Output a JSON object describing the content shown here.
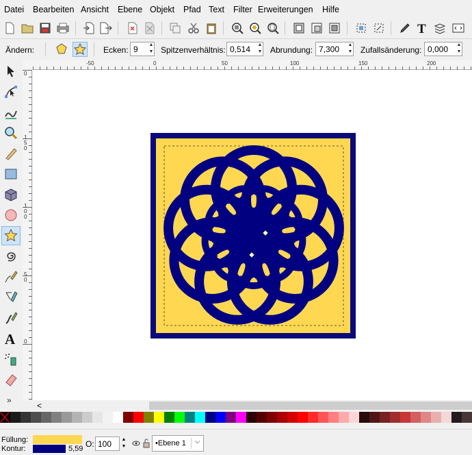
{
  "menu": [
    "Datei",
    "Bearbeiten",
    "Ansicht",
    "Ebene",
    "Objekt",
    "Pfad",
    "Text",
    "Filter",
    "Erweiterungen",
    "Hilfe"
  ],
  "tool_controls": {
    "change_label": "Ändern:",
    "corners_label": "Ecken:",
    "corners_value": "9",
    "ratio_label": "Spitzenverhältnis:",
    "ratio_value": "0,514",
    "rounding_label": "Abrundung:",
    "rounding_value": "7,300",
    "random_label": "Zufallsänderung:",
    "random_value": "0,000"
  },
  "ruler_h": [
    "-50",
    "0",
    "50",
    "100",
    "150",
    "200"
  ],
  "ruler_v": [
    "0",
    "1 5 0",
    "1 0 0",
    "5 0",
    "0"
  ],
  "scroll_left": "<",
  "toolbox_more": "»",
  "status": {
    "fill_label": "Füllung:",
    "stroke_label": "Kontur:",
    "stroke_width": "5,59",
    "opacity_label": "O:",
    "opacity_value": "100",
    "layer": "•Ebene 1"
  },
  "colors": {
    "fill": "#ffd751",
    "stroke": "#000080",
    "frame": "#0a0a7a",
    "selection_bg": "#cde3f7"
  },
  "palette": [
    "#000000",
    "#1a1a1a",
    "#333333",
    "#4d4d4d",
    "#666666",
    "#808080",
    "#999999",
    "#b3b3b3",
    "#cccccc",
    "#e6e6e6",
    "#f2f2f2",
    "#ffffff",
    "#800000",
    "#ff0000",
    "#808000",
    "#ffff00",
    "#008000",
    "#00ff00",
    "#008080",
    "#00ffff",
    "#000080",
    "#0000ff",
    "#800080",
    "#ff00ff",
    "#2b0000",
    "#550000",
    "#800000",
    "#aa0000",
    "#d40000",
    "#ff0000",
    "#ff2a2a",
    "#ff5555",
    "#ff8080",
    "#ffaaaa",
    "#ffd5d5",
    "#280b0b",
    "#501616",
    "#782121",
    "#a02c2c",
    "#c83737",
    "#d35f5f",
    "#de8787",
    "#e9afaf",
    "#f4d7d7",
    "#241c1c",
    "#483737"
  ]
}
